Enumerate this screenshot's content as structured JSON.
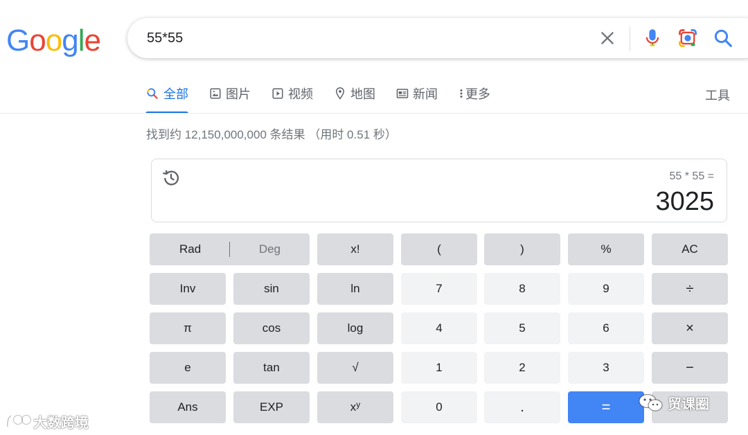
{
  "logo": {
    "letters": [
      "G",
      "o",
      "o",
      "g",
      "l",
      "e"
    ],
    "colors": [
      "#4285F4",
      "#EA4335",
      "#FBBC05",
      "#4285F4",
      "#34A853",
      "#EA4335"
    ]
  },
  "search": {
    "query": "55*55"
  },
  "tabs": [
    {
      "label": "全部",
      "icon": "search-icon"
    },
    {
      "label": "图片",
      "icon": "image-icon"
    },
    {
      "label": "视频",
      "icon": "video-icon"
    },
    {
      "label": "地图",
      "icon": "map-pin-icon"
    },
    {
      "label": "新闻",
      "icon": "news-icon"
    },
    {
      "label": "更多",
      "icon": "more-icon"
    }
  ],
  "tools_label": "工具",
  "result_stats": "找到约 12,150,000,000 条结果 （用时 0.51 秒）",
  "calculator": {
    "expression": "55 * 55 =",
    "result": "3025",
    "rad_label": "Rad",
    "deg_label": "Deg",
    "keys": [
      [
        "x!",
        "(",
        ")",
        "%",
        "AC"
      ],
      [
        "Inv",
        "sin",
        "ln",
        "7",
        "8",
        "9",
        "÷"
      ],
      [
        "π",
        "cos",
        "log",
        "4",
        "5",
        "6",
        "×"
      ],
      [
        "e",
        "tan",
        "√",
        "1",
        "2",
        "3",
        "−"
      ],
      [
        "Ans",
        "EXP",
        "x",
        "0",
        ".",
        "=",
        "+"
      ]
    ],
    "power_sup": "y"
  },
  "watermarks": {
    "left_text": "大数跨境",
    "right_text": "贸课圈"
  },
  "colors": {
    "accent": "#1a73e8",
    "equals": "#4285f4",
    "func_key": "#dadce0",
    "num_key": "#f1f3f4"
  }
}
